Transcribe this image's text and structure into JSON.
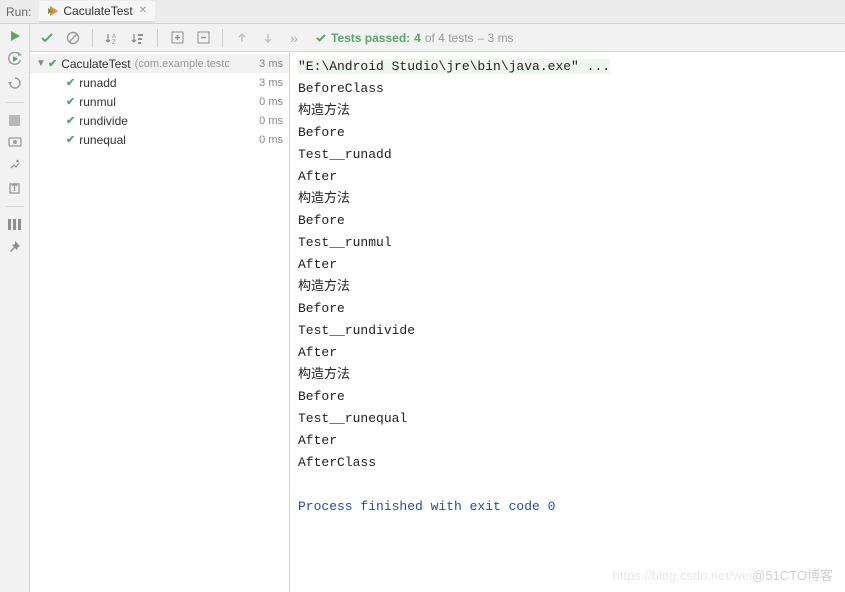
{
  "header": {
    "run_label": "Run:",
    "tab_name": "CaculateTest"
  },
  "toolbar": {
    "status_prefix": "Tests passed:",
    "status_passed": "4",
    "status_of": "of 4 tests",
    "status_time": "– 3 ms"
  },
  "tree": {
    "root": {
      "name": "CaculateTest",
      "meta": "(com.example.testc",
      "time": "3 ms"
    },
    "items": [
      {
        "name": "runadd",
        "time": "3 ms"
      },
      {
        "name": "runmul",
        "time": "0 ms"
      },
      {
        "name": "rundivide",
        "time": "0 ms"
      },
      {
        "name": "runequal",
        "time": "0 ms"
      }
    ]
  },
  "console": {
    "cmd": "\"E:\\Android Studio\\jre\\bin\\java.exe\" ...",
    "lines": [
      "BeforeClass",
      "构造方法",
      "Before",
      "Test__runadd",
      "After",
      "构造方法",
      "Before",
      "Test__runmul",
      "After",
      "构造方法",
      "Before",
      "Test__rundivide",
      "After",
      "构造方法",
      "Before",
      "Test__runequal",
      "After",
      "AfterClass"
    ],
    "exit": "Process finished with exit code 0"
  },
  "watermark": {
    "faded": "https://blog.csdn.net/wei",
    "visible": "@51CTO博客"
  }
}
